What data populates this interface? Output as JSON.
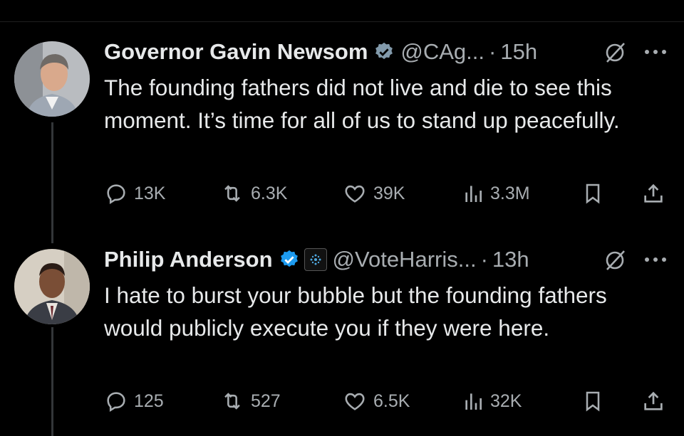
{
  "tweets": [
    {
      "name": "Governor Gavin Newsom",
      "handle": "@CAg...",
      "separator": "·",
      "time": "15h",
      "text": "The founding fathers did not live and die to see this moment. It’s time for all of us to stand up peacefully.",
      "stats": {
        "replies": "13K",
        "reposts": "6.3K",
        "likes": "39K",
        "views": "3.3M"
      }
    },
    {
      "name": "Philip Anderson",
      "handle": "@VoteHarris...",
      "separator": "·",
      "time": "13h",
      "text": "I hate to burst your bubble but the founding fathers would publicly execute you if they were here.",
      "stats": {
        "replies": "125",
        "reposts": "527",
        "likes": "6.5K",
        "views": "32K"
      }
    }
  ],
  "colors": {
    "background": "#000000",
    "text": "#e7e9ea",
    "muted": "#a8adb1",
    "verified": "#1d9bf0"
  }
}
